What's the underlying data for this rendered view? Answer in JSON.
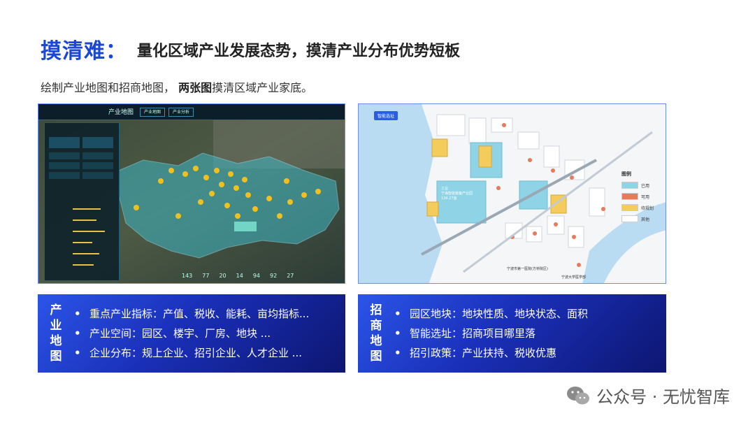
{
  "header": {
    "key": "摸清难：",
    "title": "量化区域产业发展态势，摸清产业分布优势短板"
  },
  "subtitle": {
    "prefix": "绘制产业地图和招商地图，",
    "bold": "两张图",
    "suffix": "摸清区域产业家底。"
  },
  "left_screenshot": {
    "title": "产业地图",
    "tabs": [
      "产业地图",
      "产业分析"
    ],
    "stats": [
      "143",
      "77",
      "20",
      "14",
      "94",
      "92",
      "27"
    ]
  },
  "right_screenshot": {
    "button": "智能选址",
    "legend_title": "图例",
    "legend": [
      {
        "label": "已用",
        "color": "#8fd3e6"
      },
      {
        "label": "可用",
        "color": "#e57a5c"
      },
      {
        "label": "待规划",
        "color": "#f3cc5c"
      },
      {
        "label": "其他",
        "color": "#ffffff"
      }
    ],
    "area_label": "工业\n宁海智能装备产业园\n134.27亩",
    "place_labels": [
      "宁波市第一医院(方桥院区)",
      "宁波大学医学部"
    ]
  },
  "industry_map": {
    "label_chars": [
      "产",
      "业",
      "地",
      "图"
    ],
    "items": [
      "重点产业指标：产值、税收、能耗、亩均指标...",
      "产业空间：园区、楼宇、厂房、地块 ...",
      "企业分布：规上企业、招引企业、人才企业 ..."
    ]
  },
  "investment_map": {
    "label_chars": [
      "招",
      "商",
      "地",
      "图"
    ],
    "items": [
      "园区地块：地块性质、地块状态、面积",
      "智能选址：招商项目哪里落",
      "招引政策：产业扶持、税收优惠"
    ]
  },
  "watermark": {
    "text": "公众号 · 无忧智库",
    "icon": "wechat-icon"
  }
}
